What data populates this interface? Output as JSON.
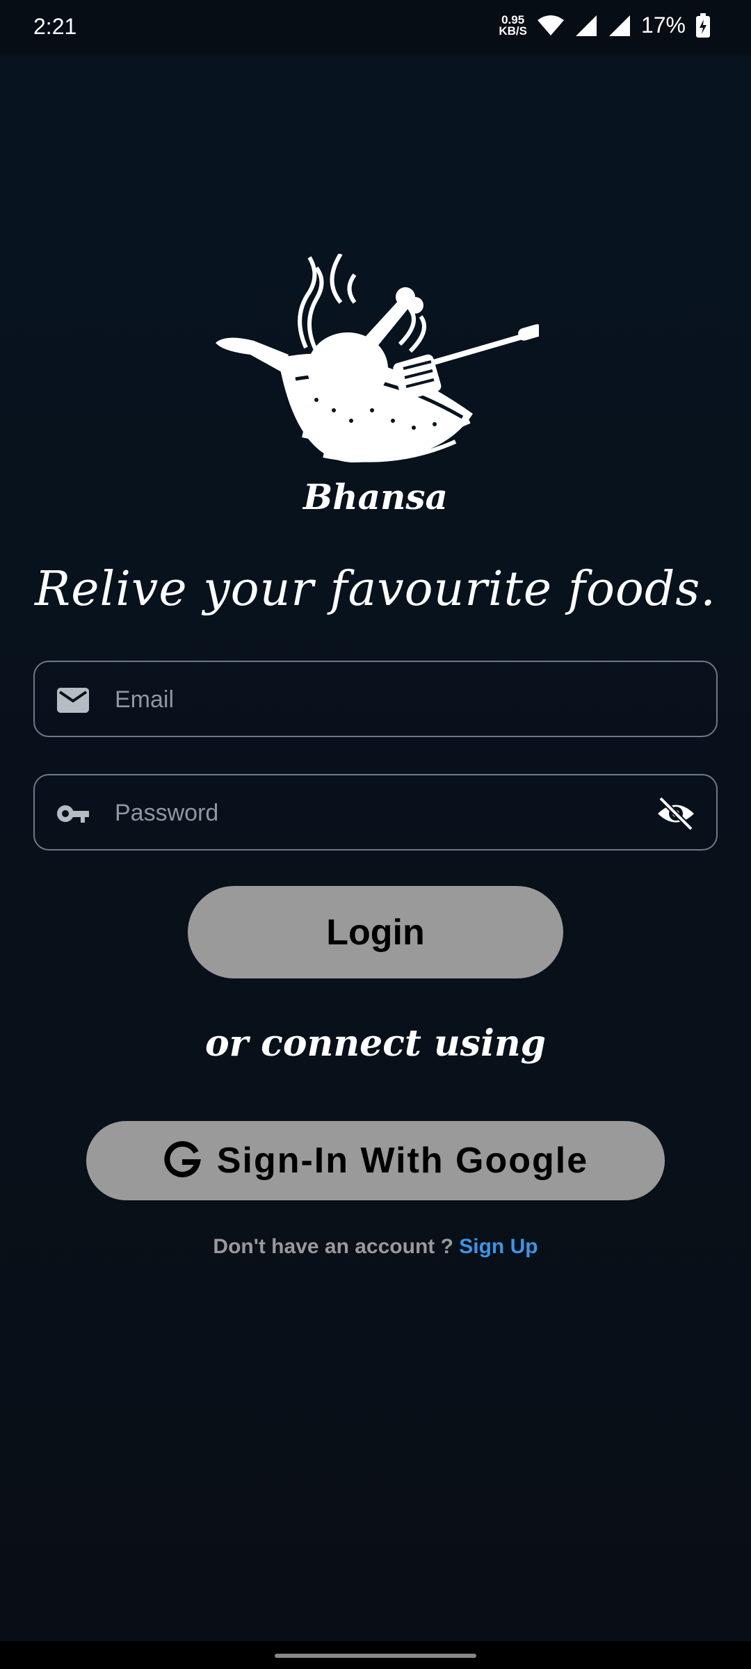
{
  "status_bar": {
    "time": "2:21",
    "net_speed_value": "0.95",
    "net_speed_unit": "KB/S",
    "battery": "17%"
  },
  "logo": {
    "brand": "Bhansa"
  },
  "tagline": "Relive your favourite foods.",
  "email_field": {
    "placeholder": "Email",
    "icon": "mail-icon"
  },
  "password_field": {
    "placeholder": "Password",
    "icon": "key-icon",
    "toggle_icon": "eye-off-icon"
  },
  "login_button": {
    "label": "Login"
  },
  "divider_text": "or connect using",
  "google_button": {
    "label": "Sign-In With Google",
    "icon": "google-icon"
  },
  "signup": {
    "prompt": "Don't have an account ?",
    "link": "Sign Up",
    "link_color": "#3c95e6"
  },
  "colors": {
    "background": "#08111b",
    "button": "#9a9a9a",
    "field_border": "#6e7a86"
  }
}
